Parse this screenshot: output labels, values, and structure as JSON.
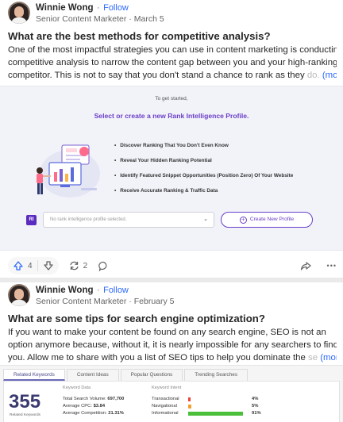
{
  "post1": {
    "author": "Winnie Wong",
    "follow": "Follow",
    "credential": "Senior Content Marketer",
    "date": "March 5",
    "title": "What are the best methods for competitive analysis?",
    "lines": [
      "One of the most impactful strategies you can use in content marketing is conducting",
      "competitive analysis to narrow the content gap between you and your high-ranking"
    ],
    "last_line": "competitor. This is not to say that you don't stand a chance to rank as they ",
    "last_line_fade": "do.",
    "more": "(more)"
  },
  "rank_card": {
    "to_get_started": "To get started,",
    "heading": "Select or create a new Rank Intelligence Profile.",
    "features": [
      "Discover Ranking That You Don't Even Know",
      "Reveal Your Hidden Ranking Potential",
      "Identify Featured Snippet Opportunities (Position Zero) Of Your Website",
      "Receive Accurate Ranking & Traffic Data"
    ],
    "badge": "RI",
    "select_placeholder": "No rank intelligence profile selected.",
    "create_button": "Create New Profile"
  },
  "actions": {
    "upvotes": "4",
    "shares": "2",
    "more_glyph": "•••"
  },
  "post2": {
    "author": "Winnie Wong",
    "follow": "Follow",
    "credential": "Senior Content Marketer",
    "date": "February 5",
    "title": "What are some tips for search engine optimization?",
    "lines": [
      "If you want to make your content be found on any search engine, SEO is not an",
      "option anymore because, without it, it is nearly impossible for any searchers to find"
    ],
    "last_line": "you. Allow me to share with you a list of SEO tips to help you dominate the ",
    "last_line_fade": "se",
    "more": "(more)"
  },
  "keywords_card": {
    "tabs": [
      "Related Keywords",
      "Content Ideas",
      "Popular Questions",
      "Trending Searches"
    ],
    "count": "355",
    "count_label": "Related Keywords",
    "data_title": "Keyword Data",
    "total_search_volume_label": "Total Search Volume:",
    "total_search_volume": "697,700",
    "avg_cpc_label": "Average CPC:",
    "avg_cpc": "$3.84",
    "avg_competition_label": "Average Competition:",
    "avg_competition": "21.31%",
    "intent_title": "Keyword Intent",
    "intent": [
      {
        "label": "Transactional",
        "pct": "4%",
        "value": 4,
        "color": "#e8453c"
      },
      {
        "label": "Navigational",
        "pct": "5%",
        "value": 5,
        "color": "#f0a030"
      },
      {
        "label": "Informational",
        "pct": "91%",
        "value": 91,
        "color": "#4cbf3a"
      }
    ]
  }
}
